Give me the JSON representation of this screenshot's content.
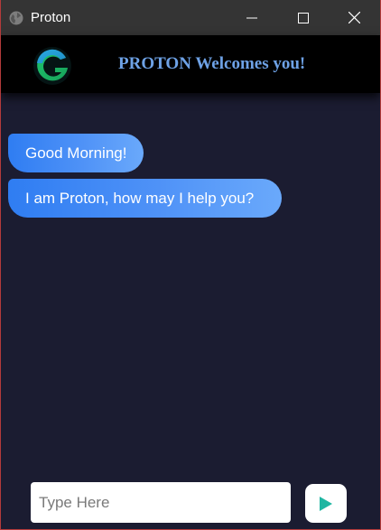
{
  "window": {
    "title": "Proton",
    "controls": [
      "minimize",
      "maximize",
      "close"
    ]
  },
  "header": {
    "title": "PROTON Welcomes you!",
    "logo_icon": "proton-g-logo-icon"
  },
  "messages": [
    {
      "text": "Good Morning!"
    },
    {
      "text": "I am Proton, how may I help you?"
    }
  ],
  "composer": {
    "placeholder": "Type Here",
    "value": "",
    "send_icon": "play-send-icon"
  },
  "colors": {
    "background": "#1b1c31",
    "header_bg": "#000000",
    "header_title": "#6ea2e6",
    "bubble_start": "#2f7df2",
    "bubble_end": "#6aa9fb",
    "send_icon": "#1fb6a2",
    "titlebar": "#343434"
  }
}
